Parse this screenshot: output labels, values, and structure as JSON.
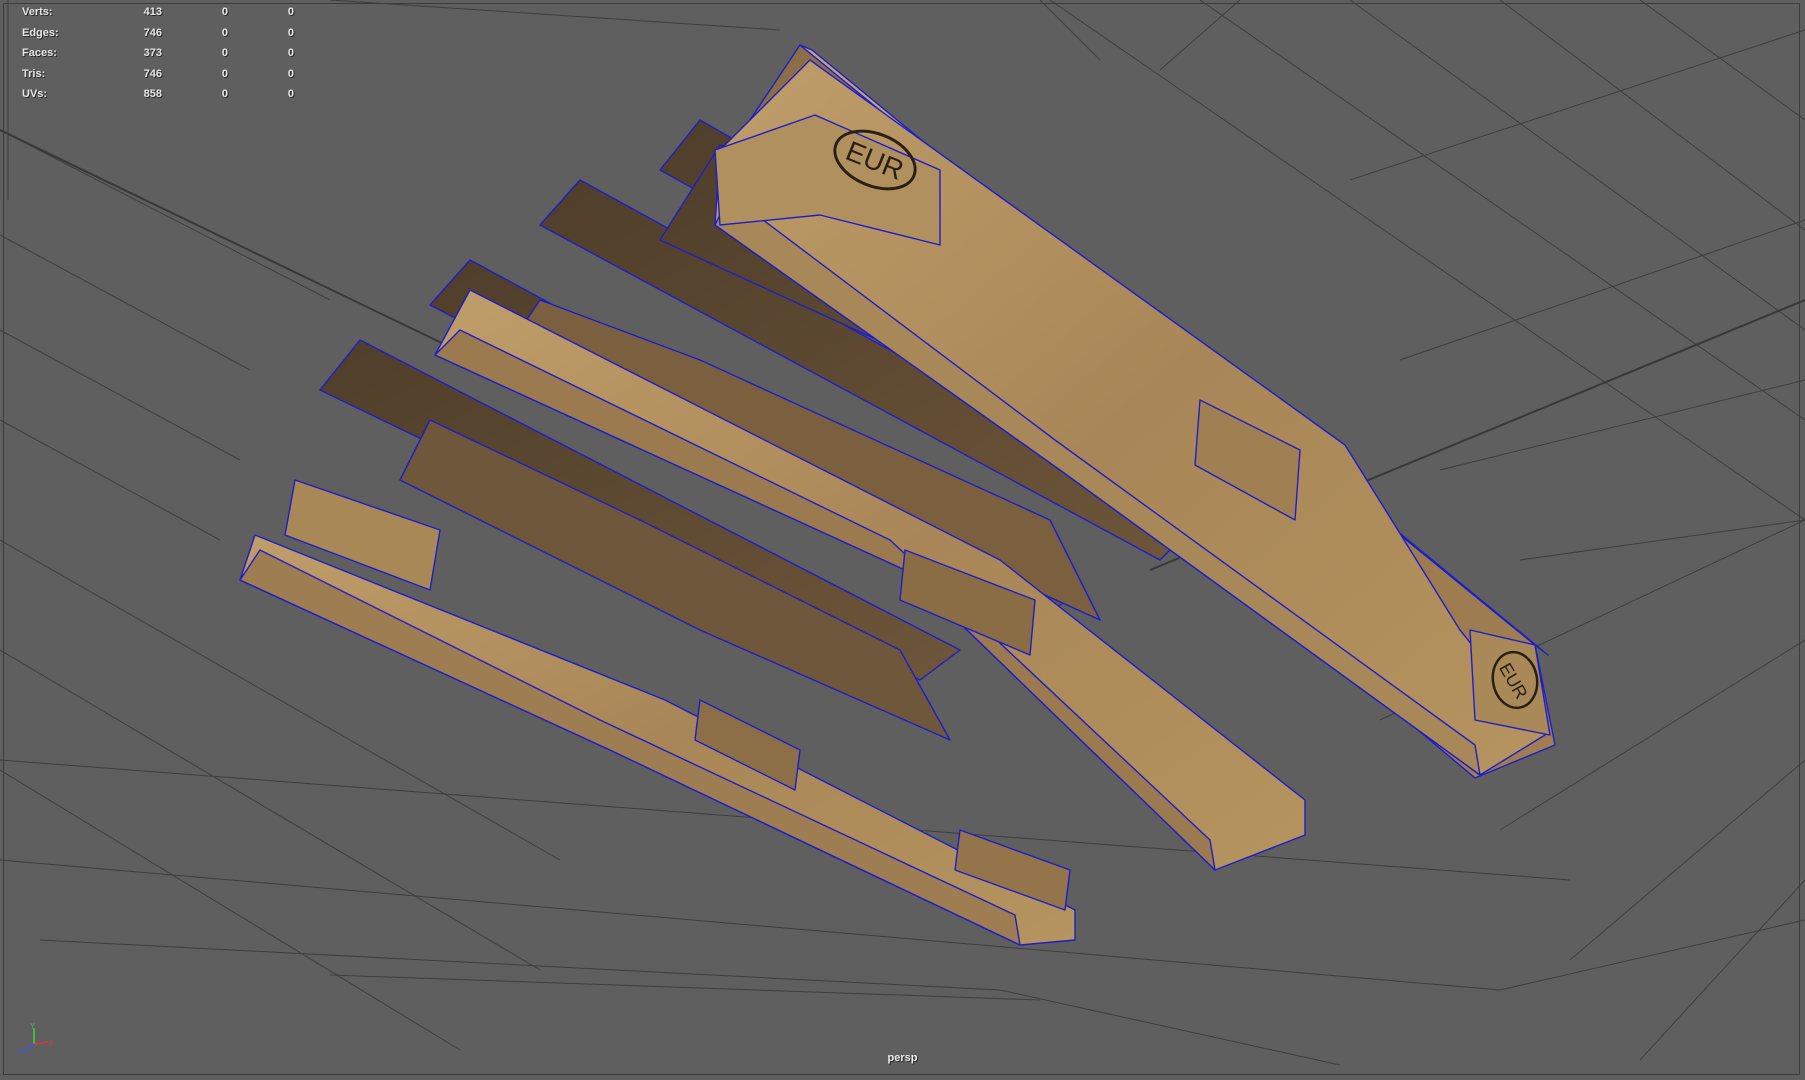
{
  "poly_count": {
    "rows": [
      {
        "label": "Verts:",
        "values": [
          "413",
          "0",
          "0"
        ]
      },
      {
        "label": "Edges:",
        "values": [
          "746",
          "0",
          "0"
        ]
      },
      {
        "label": "Faces:",
        "values": [
          "373",
          "0",
          "0"
        ]
      },
      {
        "label": "Tris:",
        "values": [
          "746",
          "0",
          "0"
        ]
      },
      {
        "label": "UVs:",
        "values": [
          "858",
          "0",
          "0"
        ]
      }
    ]
  },
  "viewport": {
    "camera_name": "persp",
    "background_color": "#5f5f5f",
    "grid_color": "#3e3e3e",
    "wireframe_color": "#1e1ec8"
  },
  "model": {
    "stamp_text": "EUR",
    "wood_light": "#b89664",
    "wood_mid": "#97774e",
    "wood_dark": "#5e4a33"
  },
  "axis_gizmo": {
    "x_label": "X",
    "y_label": "Y",
    "z_label": "Z"
  }
}
